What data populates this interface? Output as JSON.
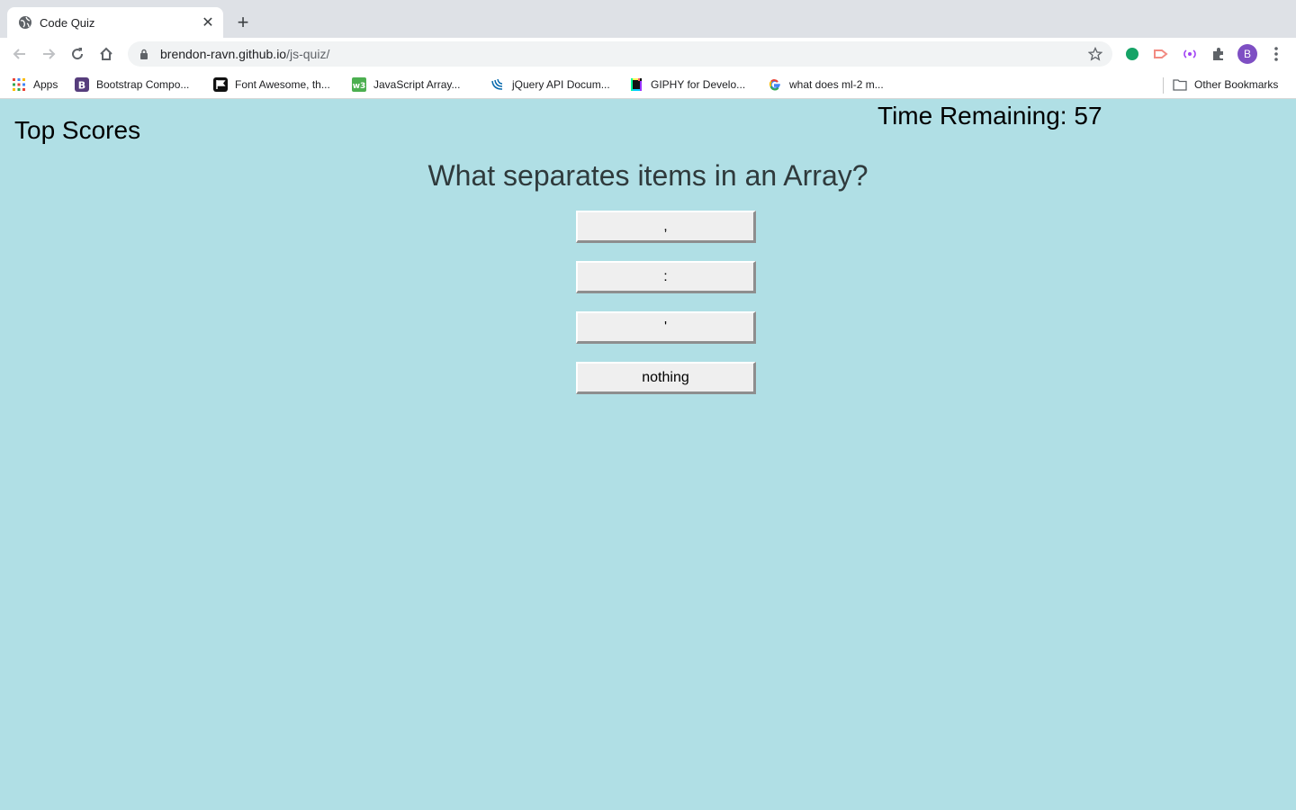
{
  "browser": {
    "tab_title": "Code Quiz",
    "url_host": "brendon-ravn.github.io",
    "url_path": "/js-quiz/",
    "profile_initial": "B",
    "bookmarks": [
      {
        "label": "Apps",
        "icon": "apps-grid-icon"
      },
      {
        "label": "Bootstrap Compo...",
        "icon": "bootstrap-icon"
      },
      {
        "label": "Font Awesome, th...",
        "icon": "font-awesome-icon"
      },
      {
        "label": "JavaScript Array...",
        "icon": "w3schools-icon"
      },
      {
        "label": "jQuery API Docum...",
        "icon": "jquery-icon"
      },
      {
        "label": "GIPHY for Develo...",
        "icon": "giphy-icon"
      },
      {
        "label": "what does ml-2 m...",
        "icon": "google-icon"
      }
    ],
    "other_bookmarks": "Other Bookmarks"
  },
  "quiz": {
    "top_scores": "Top Scores",
    "timer": "Time Remaining: 57",
    "question": "What separates items in an Array?",
    "answers": [
      ",",
      ":",
      "'",
      "nothing"
    ]
  }
}
